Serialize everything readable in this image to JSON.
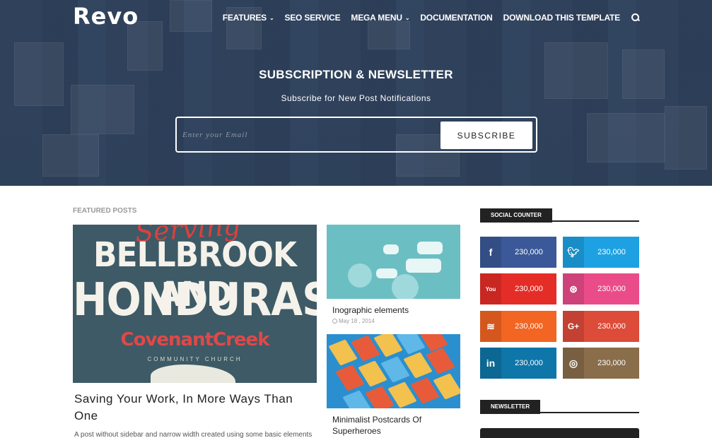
{
  "header": {
    "logo": "Revo",
    "nav": [
      {
        "label": "FEATURES",
        "has_dropdown": true
      },
      {
        "label": "SEO SERVICE",
        "has_dropdown": false
      },
      {
        "label": "MEGA MENU",
        "has_dropdown": true
      },
      {
        "label": "DOCUMENTATION",
        "has_dropdown": false
      },
      {
        "label": "DOWNLOAD THIS TEMPLATE",
        "has_dropdown": false
      }
    ],
    "search_icon": "search-icon"
  },
  "hero": {
    "title": "SUBSCRIPTION & NEWSLETTER",
    "subtitle": "Subscribe for New Post Notifications",
    "email_placeholder": "Enter your Email",
    "subscribe_label": "SUBSCRIBE"
  },
  "featured": {
    "label": "FEATURED POSTS",
    "main_post": {
      "image_text": [
        "Serving",
        "BELLBROOK AND",
        "HONDURAS",
        "CovenantCreek",
        "COMMUNITY CHURCH"
      ],
      "title": "Saving Your Work, In More Ways Than One",
      "excerpt": "A post without sidebar and narrow width created using some basic elements"
    },
    "side_posts": [
      {
        "title": "Inographic elements",
        "date": "May 18 , 2014"
      },
      {
        "title": "Minimalist Postcards Of Superheroes",
        "date": ""
      }
    ]
  },
  "sidebar": {
    "social_counter_title": "SOCIAL COUNTER",
    "social": [
      {
        "network": "facebook",
        "icon": "f",
        "count": "230,000",
        "color": "#3b5998"
      },
      {
        "network": "twitter",
        "icon": "t",
        "count": "230,000",
        "color": "#1da1e2"
      },
      {
        "network": "youtube",
        "icon": "You",
        "count": "230,000",
        "color": "#e52d27"
      },
      {
        "network": "dribbble",
        "icon": "⊛",
        "count": "230,000",
        "color": "#ea4c89"
      },
      {
        "network": "rss",
        "icon": "≋",
        "count": "230,000",
        "color": "#f26522"
      },
      {
        "network": "google-plus",
        "icon": "G+",
        "count": "230,000",
        "color": "#dd4b39"
      },
      {
        "network": "linkedin",
        "icon": "in",
        "count": "230,000",
        "color": "#0e76a8"
      },
      {
        "network": "instagram",
        "icon": "◎",
        "count": "230,000",
        "color": "#8a6d4b"
      }
    ],
    "newsletter_title": "NEWSLETTER"
  }
}
